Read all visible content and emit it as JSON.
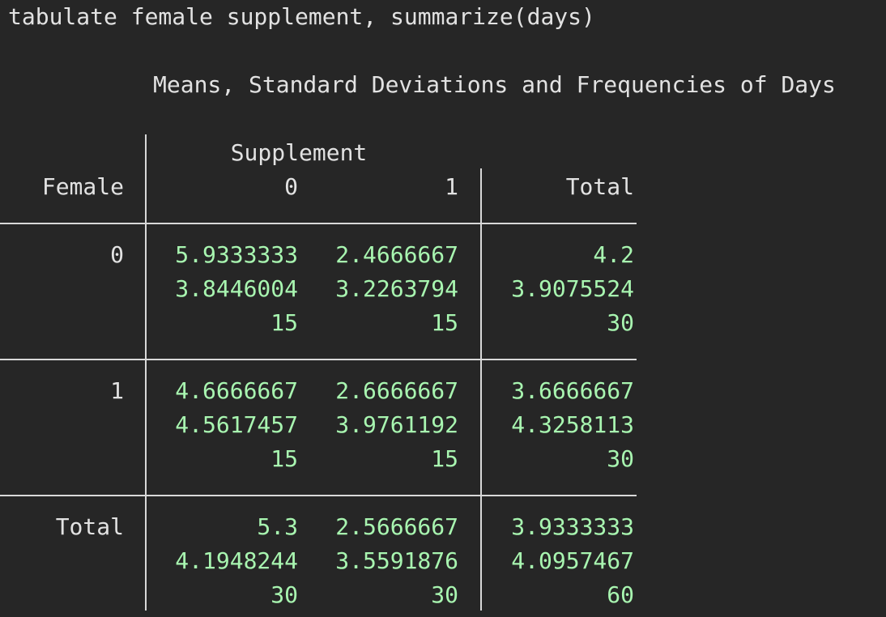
{
  "command": "tabulate female supplement, summarize(days)",
  "table_title": "Means, Standard Deviations and Frequencies of Days",
  "col_var_label": "Supplement",
  "row_var_label": "Female",
  "col_headers": [
    "0",
    "1",
    "Total"
  ],
  "rows": [
    {
      "label": "0",
      "cells": [
        [
          "5.9333333",
          "2.4666667",
          "4.2"
        ],
        [
          "3.8446004",
          "3.2263794",
          "3.9075524"
        ],
        [
          "15",
          "15",
          "30"
        ]
      ]
    },
    {
      "label": "1",
      "cells": [
        [
          "4.6666667",
          "2.6666667",
          "3.6666667"
        ],
        [
          "4.5617457",
          "3.9761192",
          "4.3258113"
        ],
        [
          "15",
          "15",
          "30"
        ]
      ]
    },
    {
      "label": "Total",
      "cells": [
        [
          "5.3",
          "2.5666667",
          "3.9333333"
        ],
        [
          "4.1948244",
          "3.5591876",
          "4.0957467"
        ],
        [
          "30",
          "30",
          "60"
        ]
      ]
    }
  ],
  "colors": {
    "background": "#262626",
    "text": "#e2e2e2",
    "values": "#a8f5b0"
  }
}
